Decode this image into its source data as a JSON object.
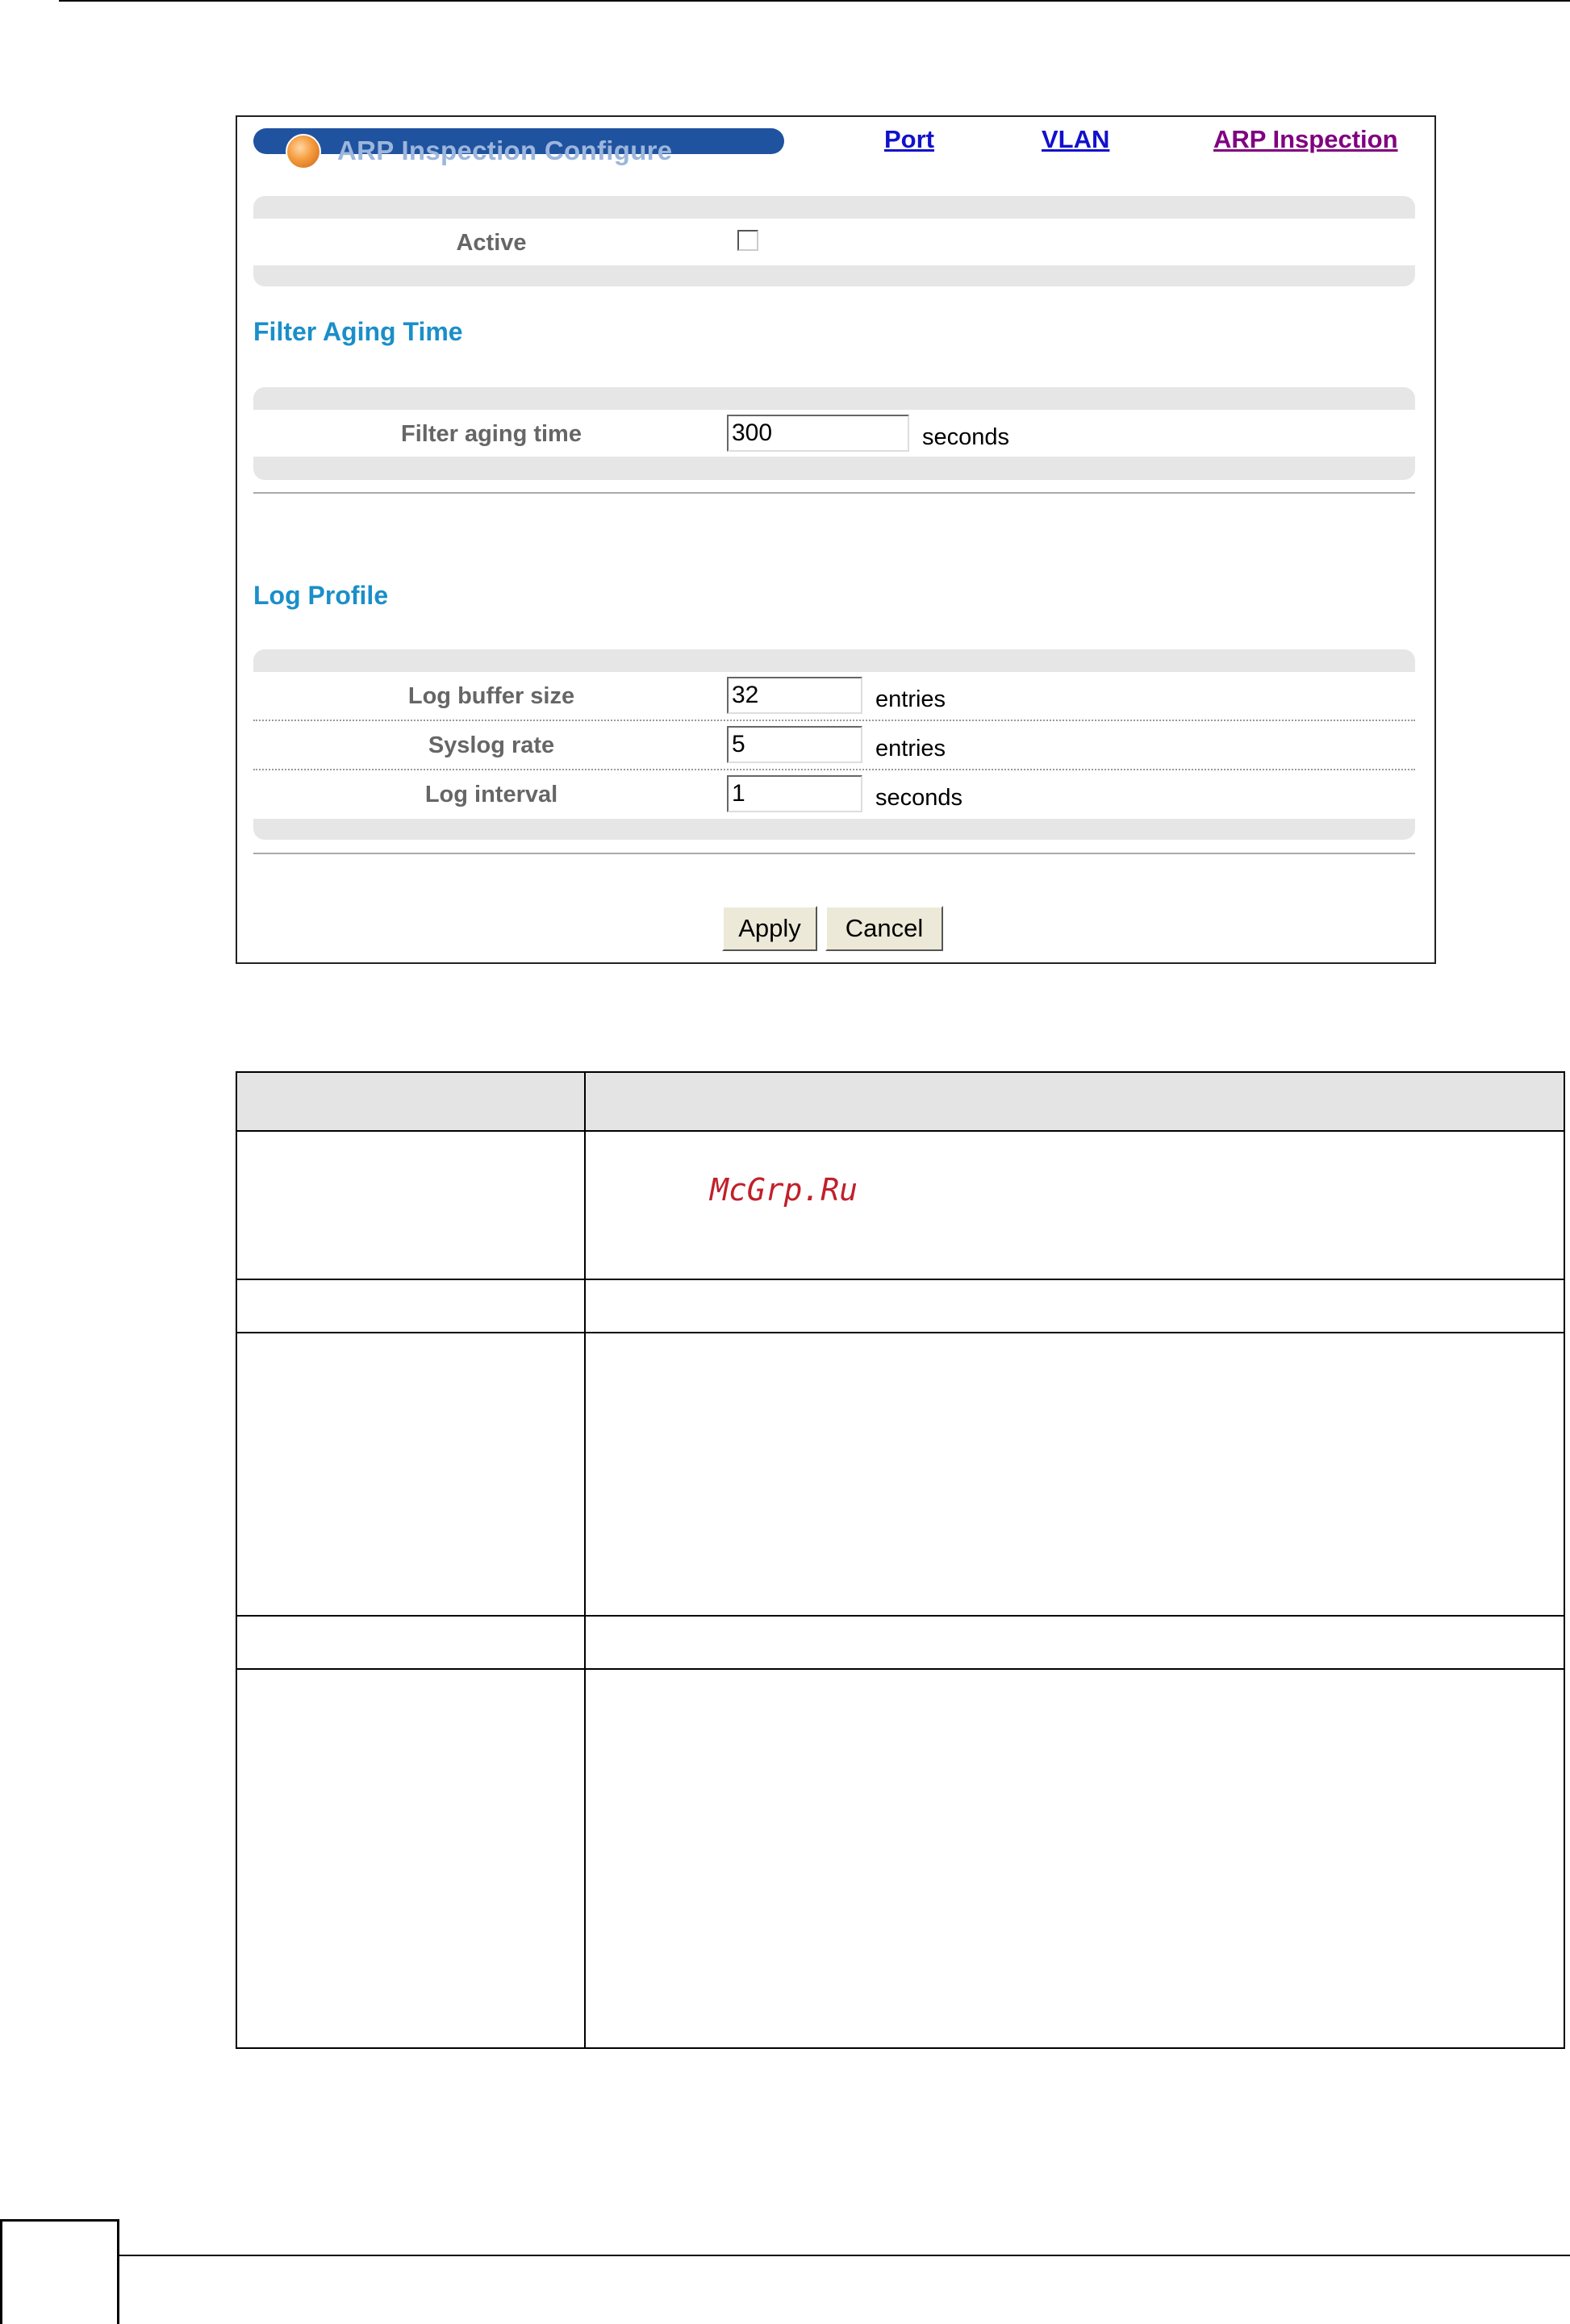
{
  "screen": {
    "title": "ARP Inspection Configure",
    "nav_links": {
      "port": "Port",
      "vlan": "VLAN",
      "arp_inspection": "ARP Inspection"
    },
    "active": {
      "label": "Active",
      "checked": false
    },
    "filter_aging": {
      "heading": "Filter Aging Time",
      "label": "Filter aging time",
      "value": "300",
      "unit": "seconds"
    },
    "log_profile": {
      "heading": "Log Profile",
      "buffer_size": {
        "label": "Log buffer size",
        "value": "32",
        "unit": "entries"
      },
      "syslog_rate": {
        "label": "Syslog rate",
        "value": "5",
        "unit": "entries"
      },
      "log_interval": {
        "label": "Log interval",
        "value": "1",
        "unit": "seconds"
      }
    },
    "buttons": {
      "apply": "Apply",
      "cancel": "Cancel"
    }
  },
  "watermark": "McGrp.Ru",
  "colors": {
    "title_pill": "#1f53a0",
    "link": "#1111cc",
    "visited_link": "#800080",
    "section_heading": "#1a8fc9",
    "watermark": "#c0202a"
  }
}
